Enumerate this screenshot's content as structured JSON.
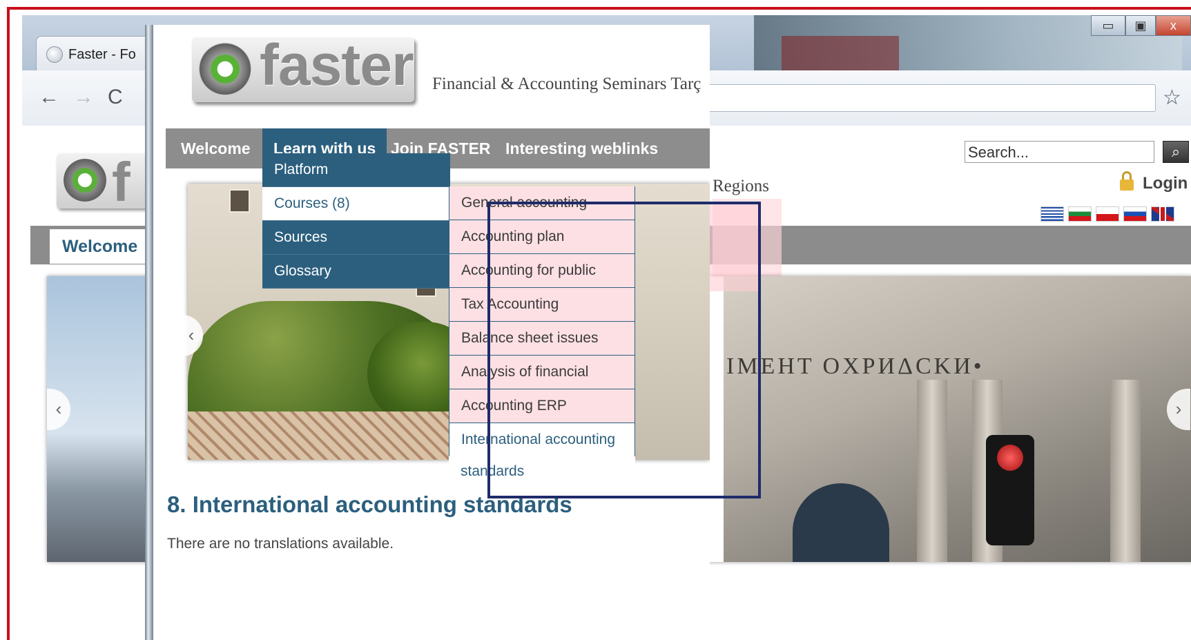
{
  "browser": {
    "tab_title": "Faster - Fo",
    "nav": {
      "back_icon": "←",
      "forward_icon": "→",
      "reload_icon": "C"
    },
    "window_controls": {
      "minimize": "▭",
      "maximize": "▣",
      "close": "x"
    },
    "bookmark_icon": "☆",
    "menu_icon": "≡"
  },
  "background_page": {
    "logo_letter": "f",
    "search_placeholder": "Search...",
    "search_icon": "⌕",
    "login_label": "Login",
    "nav_welcome": "Welcome",
    "regions_text": "Regions",
    "slider_engraving": "IMEHT OXPИΔCKИ•",
    "flags": [
      "greece-flag",
      "bulgaria-flag",
      "poland-flag",
      "slovakia-flag",
      "uk-flag"
    ]
  },
  "site": {
    "logo_text": "faster",
    "tagline": "Financial & Accounting Seminars Tarç",
    "nav": {
      "welcome": "Welcome",
      "learn": "Learn with us",
      "join": "Join FASTER",
      "weblinks": "Interesting weblinks"
    },
    "learn_menu": [
      "Platform",
      "Courses (8)",
      "Sources",
      "Glossary"
    ],
    "courses_menu": [
      "General accounting",
      "Accounting plan",
      "Accounting for public",
      "Tax Accounting",
      "Balance sheet issues",
      "Analysis of financial",
      "Accounting ERP",
      "International accounting"
    ],
    "courses_menu_continuation": "standards",
    "arrow_left": "‹",
    "heading": "8. International accounting standards",
    "note": "There are no translations available."
  },
  "colors": {
    "nav_gray": "#8d8d8d",
    "brand_blue": "#2c5f7e",
    "submenu_pink": "#fde0e4",
    "annotation_red": "#c8101a",
    "highlight_navy": "#1f2b6a"
  }
}
